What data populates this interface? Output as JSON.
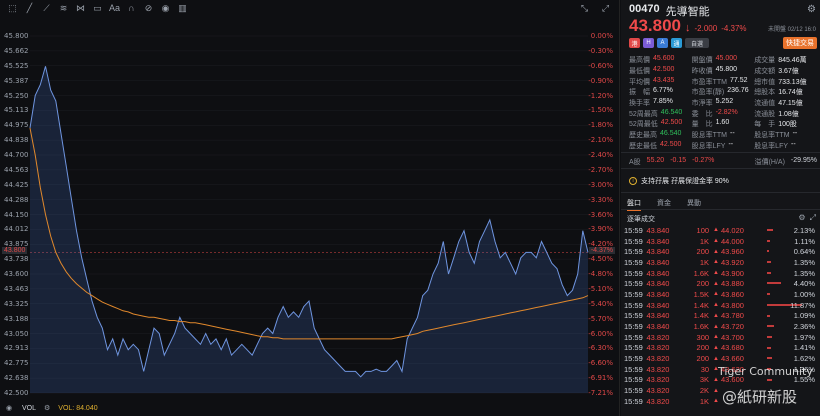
{
  "toolbar": {
    "icons": [
      "cursor-icon",
      "line-icon",
      "ray-icon",
      "channel-icon",
      "fib-icon",
      "shape-icon",
      "text-icon",
      "magnet-icon",
      "lock-icon",
      "eye-icon",
      "trash-icon"
    ],
    "text_tool_label": "Aa"
  },
  "chart": {
    "left_ticks": [
      "45.800",
      "45.662",
      "45.525",
      "45.387",
      "45.250",
      "45.113",
      "44.975",
      "44.838",
      "44.700",
      "44.563",
      "44.425",
      "44.288",
      "44.150",
      "44.012",
      "43.875",
      "43.738",
      "43.600",
      "43.463",
      "43.325",
      "43.188",
      "43.050",
      "42.913",
      "42.775",
      "42.638",
      "42.500"
    ],
    "right_ticks": [
      "0.00%",
      "-0.30%",
      "-0.60%",
      "-0.90%",
      "-1.20%",
      "-1.50%",
      "-1.80%",
      "-2.10%",
      "-2.40%",
      "-2.70%",
      "-3.00%",
      "-3.30%",
      "-3.60%",
      "-3.90%",
      "-4.20%",
      "-4.50%",
      "-4.80%",
      "-5.10%",
      "-5.40%",
      "-5.70%",
      "-6.00%",
      "-6.30%",
      "-6.60%",
      "-6.91%",
      "-7.21%"
    ],
    "current_price_tag": "43.800",
    "current_pct_tag": "-4.37%",
    "price_min": 42.5,
    "price_max": 45.8,
    "price_line": [
      44.95,
      45.25,
      45.35,
      45.52,
      45.3,
      45.2,
      44.9,
      44.6,
      44.3,
      44.0,
      43.75,
      43.55,
      43.35,
      43.2,
      43.1,
      42.9,
      43.0,
      42.85,
      43.0,
      42.9,
      42.95,
      42.9,
      42.7,
      42.9,
      43.1,
      43.05,
      42.85,
      42.95,
      43.05,
      43.2,
      43.1,
      43.05,
      43.0,
      42.95,
      43.05,
      42.95,
      43.0,
      42.9,
      43.0,
      42.85,
      42.9,
      42.95,
      42.9,
      42.85,
      42.95,
      43.05,
      43.1,
      43.05,
      43.2,
      43.3,
      43.2,
      43.25,
      43.2,
      43.3,
      43.35,
      43.1,
      43.0,
      42.9,
      42.85,
      42.8,
      42.75,
      42.7,
      42.7,
      42.7,
      42.65,
      42.7,
      42.7,
      42.72,
      42.7,
      42.7,
      42.75,
      42.8,
      42.7,
      43.0,
      43.1,
      43.2,
      43.4,
      43.45,
      43.6,
      43.7,
      43.9,
      43.6,
      43.75,
      43.9,
      44.0,
      43.8,
      43.7,
      43.9,
      44.0,
      44.1,
      43.9,
      43.75,
      43.8,
      43.7,
      43.6,
      43.75,
      43.8,
      43.8,
      43.75,
      43.9,
      43.8,
      43.7,
      43.65,
      43.5,
      43.4,
      43.45,
      43.6,
      44.0,
      43.8
    ],
    "avg_line": [
      44.95,
      44.7,
      44.4,
      44.15,
      43.95,
      43.8,
      43.7,
      43.62,
      43.56,
      43.51,
      43.47,
      43.43,
      43.4,
      43.37,
      43.34,
      43.32,
      43.3,
      43.28,
      43.26,
      43.25,
      43.23,
      43.22,
      43.21,
      43.2,
      43.2,
      43.19,
      43.18,
      43.17,
      43.17,
      43.16,
      43.16,
      43.15,
      43.15,
      43.14,
      43.13,
      43.12,
      43.11,
      43.1,
      43.09,
      43.08,
      43.07,
      43.06,
      43.05,
      43.04,
      43.03,
      43.02,
      43.02,
      43.01,
      43.01,
      43.0,
      43.0,
      43.0,
      43.0,
      43.0,
      43.0,
      43.0,
      43.0,
      43.0,
      43.0,
      43.0,
      43.0,
      43.0,
      43.0,
      43.0,
      43.0,
      43.0,
      43.0,
      43.0,
      43.0,
      43.0,
      43.0,
      43.01,
      43.02,
      43.03,
      43.04,
      43.05,
      43.07,
      43.08,
      43.09,
      43.1,
      43.11,
      43.12,
      43.13,
      43.14,
      43.15,
      43.16,
      43.17,
      43.18,
      43.19,
      43.2,
      43.21,
      43.22,
      43.23,
      43.24,
      43.25,
      43.26,
      43.27,
      43.28,
      43.29,
      43.3,
      43.31,
      43.32,
      43.33,
      43.34,
      43.35,
      43.36,
      43.37,
      43.38,
      43.4
    ]
  },
  "volume": {
    "label": "VOL",
    "value_label": "VOL: 84.040"
  },
  "quote": {
    "code": "00470",
    "name": "先導智能",
    "price": "43.800",
    "change": "-2.000",
    "change_pct": "-4.37%",
    "time": "未開盤 02/12 16:0",
    "badges": [
      "港",
      "H",
      "A",
      "通"
    ],
    "badge_colors": [
      "#e04848",
      "#7b5cd6",
      "#3a7bd5",
      "#2a9ad6"
    ],
    "auto_label": "自選",
    "quick_trade": "快捷交易",
    "stats": [
      [
        [
          "最高價",
          "45.600",
          "red"
        ],
        [
          "開盤價",
          "45.000",
          "red"
        ],
        [
          "成交量",
          "845.46萬",
          ""
        ]
      ],
      [
        [
          "最低價",
          "42.500",
          "red"
        ],
        [
          "昨收價",
          "45.800",
          ""
        ],
        [
          "成交額",
          "3.67億",
          ""
        ]
      ],
      [
        [
          "平均價",
          "43.435",
          "red"
        ],
        [
          "市盈率TTM",
          "77.52",
          ""
        ],
        [
          "總市值",
          "733.13億",
          ""
        ]
      ],
      [
        [
          "振　幅",
          "6.77%",
          ""
        ],
        [
          "市盈率(靜)",
          "236.76",
          ""
        ],
        [
          "總股本",
          "16.74億",
          ""
        ]
      ],
      [
        [
          "換手率",
          "7.85%",
          ""
        ],
        [
          "市淨率",
          "5.252",
          ""
        ],
        [
          "流通值",
          "47.15億",
          ""
        ]
      ],
      [
        [
          "52周最高",
          "46.540",
          "green"
        ],
        [
          "委　比",
          "-2.82%",
          "red"
        ],
        [
          "流通股",
          "1.08億",
          ""
        ]
      ],
      [
        [
          "52周最低",
          "42.500",
          "red"
        ],
        [
          "量　比",
          "1.60",
          ""
        ],
        [
          "每　手",
          "100股",
          ""
        ]
      ],
      [
        [
          "歷史最高",
          "46.540",
          "green"
        ],
        [
          "股息率TTM",
          "--",
          ""
        ],
        [
          "股息率TTM",
          "--",
          ""
        ]
      ],
      [
        [
          "歷史最低",
          "42.500",
          "red"
        ],
        [
          "股息率LFY",
          "--",
          ""
        ],
        [
          "股息率LFY",
          "--",
          ""
        ]
      ]
    ],
    "a_share": {
      "label": "A股",
      "price": "55.20",
      "chg": "-0.15",
      "pct": "-0.27%",
      "premium_label": "溢價(H/A)",
      "premium": "-29.95%"
    },
    "notice": "支持孖展 孖展保證金率 90%"
  },
  "tabs": [
    "盤口",
    "資金",
    "異動"
  ],
  "ticker": {
    "title": "逐筆成交",
    "trades": [
      [
        "15:59",
        "43.840",
        "100",
        ""
      ],
      [
        "15:59",
        "43.840",
        "1K",
        ""
      ],
      [
        "15:59",
        "43.840",
        "200",
        ""
      ],
      [
        "15:59",
        "43.840",
        "1K",
        ""
      ],
      [
        "15:59",
        "43.840",
        "1.6K",
        ""
      ],
      [
        "15:59",
        "43.840",
        "200",
        ""
      ],
      [
        "15:59",
        "43.840",
        "1.5K",
        ""
      ],
      [
        "15:59",
        "43.840",
        "1.4K",
        ""
      ],
      [
        "15:59",
        "43.840",
        "1.4K",
        ""
      ],
      [
        "15:59",
        "43.840",
        "1.6K",
        ""
      ],
      [
        "15:59",
        "43.820",
        "300",
        ""
      ],
      [
        "15:59",
        "43.820",
        "200",
        ""
      ],
      [
        "15:59",
        "43.820",
        "200",
        ""
      ],
      [
        "15:59",
        "43.820",
        "30",
        ""
      ],
      [
        "15:59",
        "43.820",
        "3K",
        ""
      ],
      [
        "15:59",
        "43.820",
        "2K",
        ""
      ],
      [
        "15:59",
        "43.820",
        "1K",
        ""
      ]
    ],
    "depth": [
      [
        "44.020",
        "2.13%",
        8
      ],
      [
        "44.000",
        "1.11%",
        4
      ],
      [
        "43.960",
        "0.64%",
        2
      ],
      [
        "43.920",
        "1.35%",
        5
      ],
      [
        "43.900",
        "1.35%",
        5
      ],
      [
        "43.880",
        "4.40%",
        18
      ],
      [
        "43.860",
        "1.00%",
        4
      ],
      [
        "43.800",
        "11.87%",
        46
      ],
      [
        "43.780",
        "1.09%",
        4
      ],
      [
        "43.720",
        "2.36%",
        9
      ],
      [
        "43.700",
        "1.97%",
        7
      ],
      [
        "43.680",
        "1.41%",
        5
      ],
      [
        "43.660",
        "1.62%",
        6
      ],
      [
        "43.620",
        "1.36%",
        5
      ],
      [
        "43.600",
        "1.55%",
        6
      ]
    ]
  },
  "watermarks": {
    "tiger": "Tiger Community",
    "handle": "@紙研新股"
  }
}
